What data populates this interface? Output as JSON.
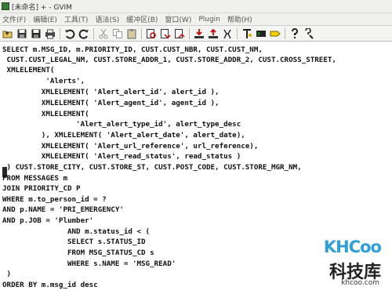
{
  "window": {
    "title": "[未命名] + - GVIM"
  },
  "menu": [
    "文件(F)",
    "编辑(E)",
    "工具(T)",
    "语法(S)",
    "缓冲区(B)",
    "窗口(W)",
    "Plugin",
    "帮助(H)"
  ],
  "toolbar": {
    "icons": [
      "open-icon",
      "save-icon",
      "save-all-icon",
      "print-icon",
      "undo-icon",
      "redo-icon",
      "cut-icon",
      "copy-icon",
      "paste-icon",
      "find-replace-icon",
      "find-next-icon",
      "find-prev-icon",
      "load-session-icon",
      "save-session-icon",
      "run-script-icon",
      "make-icon",
      "shell-icon",
      "tag-jump-icon",
      "help-icon",
      "find-help-icon"
    ]
  },
  "editor": {
    "lines": [
      "SELECT m.MSG_ID, m.PRIORITY_ID, CUST.CUST_NBR, CUST.CUST_NM,",
      " CUST.CUST_LEGAL_NM, CUST.STORE_ADDR_1, CUST.STORE_ADDR_2, CUST.CROSS_STREET,",
      " XMLELEMENT(",
      "          'Alerts',",
      "         XMLELEMENT( 'Alert_alert_id', alert_id ),",
      "         XMLELEMENT( 'Alert_agent_id', agent_id ),",
      "         XMLELEMENT(",
      "                 'Alert_alert_type_id', alert_type_desc",
      "         ), XMLELEMENT( 'Alert_alert_date', alert_date),",
      "         XMLELEMENT( 'Alert_url_reference', url_reference),",
      "         XMLELEMENT( 'Alert_read_status', read_status )",
      " ) CUST.STORE_CITY, CUST.STORE_ST, CUST.POST_CODE, CUST.STORE_MGR_NM,",
      "FROM MESSAGES m",
      "JOIN PRIORITY_CD P",
      "WHERE m.to_person_id = ?",
      "AND p.NAME = 'PRI_EMERGENCY'",
      "AND p.JOB = 'Plumber'",
      "               AND m.status_id < (",
      "               SELECT s.STATUS_ID",
      "               FROM MSG_STATUS_CD s",
      "               WHERE s.NAME = 'MSG_READ'",
      " )",
      "ORDER BY m.msg_id desc"
    ]
  },
  "watermark": {
    "logo": "KHCoo",
    "name": "科技库",
    "url": "khcoo.com"
  }
}
